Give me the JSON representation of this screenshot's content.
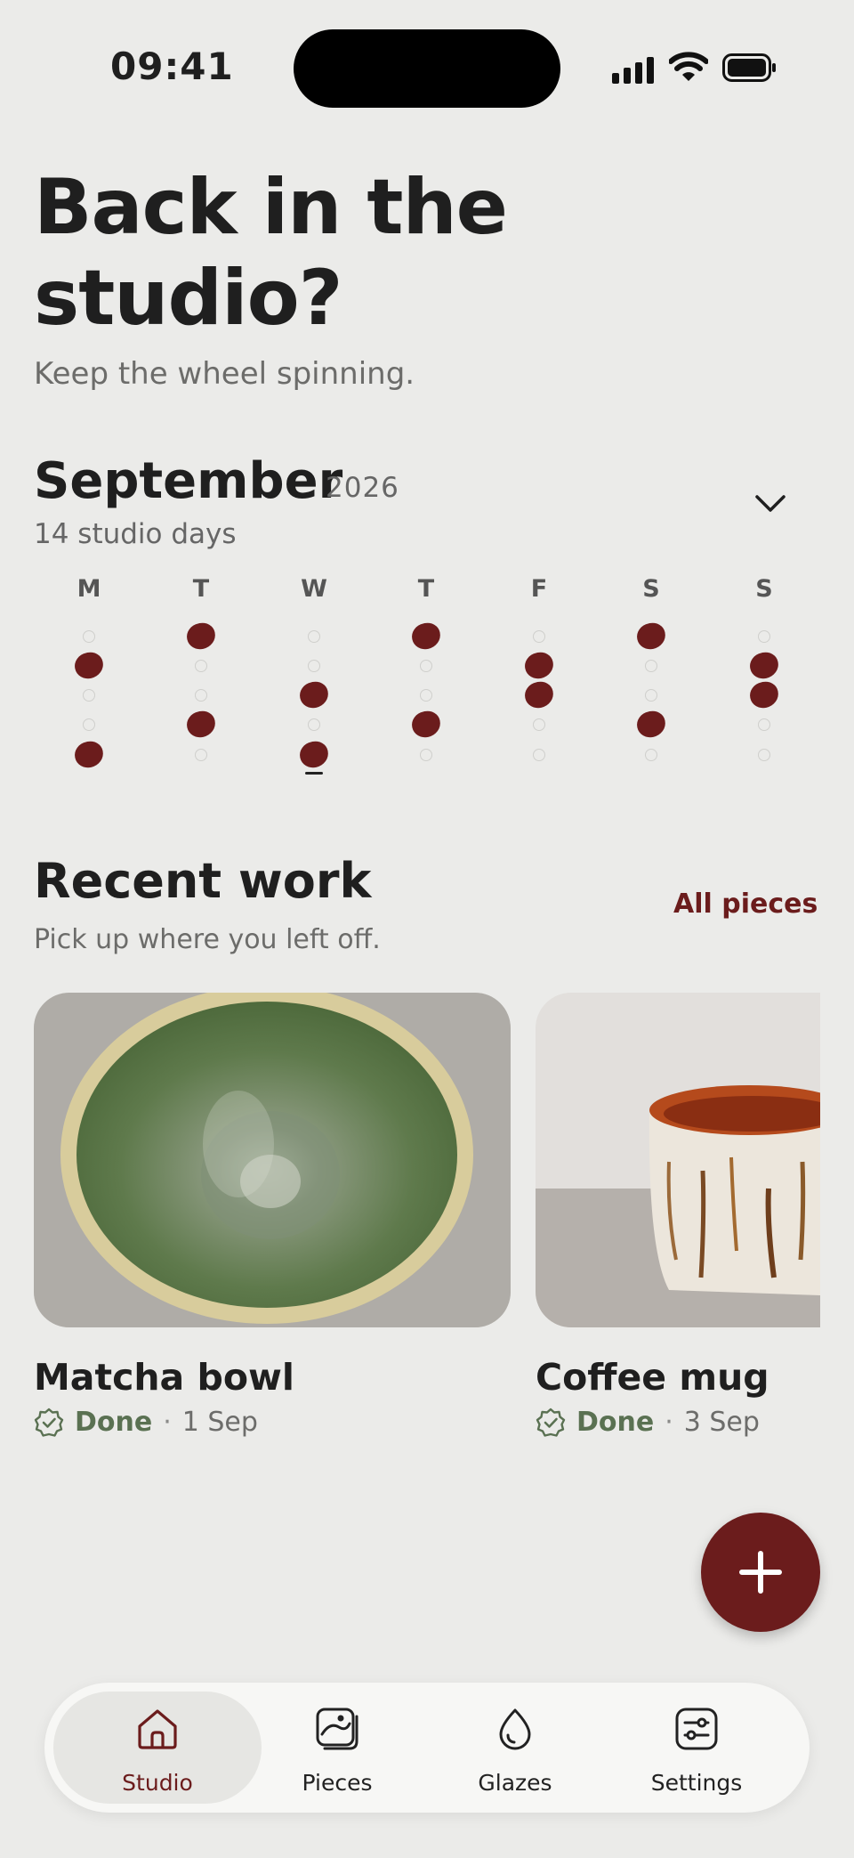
{
  "status_bar": {
    "time": "09:41"
  },
  "hero": {
    "title": "Back in the studio?",
    "subtitle": "Keep the wheel spinning."
  },
  "calendar": {
    "month": "September",
    "year": "2026",
    "studio_days": "14 studio days",
    "weekdays": [
      "M",
      "T",
      "W",
      "T",
      "F",
      "S",
      "S"
    ],
    "grid": [
      [
        0,
        1,
        0,
        0,
        1
      ],
      [
        1,
        0,
        0,
        1,
        0
      ],
      [
        0,
        0,
        1,
        0,
        1
      ],
      [
        1,
        0,
        0,
        1,
        0
      ],
      [
        0,
        1,
        1,
        0,
        0
      ],
      [
        1,
        0,
        0,
        1,
        0
      ],
      [
        0,
        1,
        1,
        0,
        0
      ]
    ],
    "today": [
      2,
      4
    ]
  },
  "recent": {
    "title": "Recent work",
    "subtitle": "Pick up where you left off.",
    "all_link": "All pieces",
    "pieces": [
      {
        "name": "Matcha bowl",
        "status": "Done",
        "date": "1 Sep"
      },
      {
        "name": "Coffee mug",
        "status": "Done",
        "date": "3 Sep"
      }
    ]
  },
  "fab": {
    "icon": "plus-icon"
  },
  "nav": {
    "items": [
      {
        "label": "Studio",
        "icon": "home-icon",
        "active": true
      },
      {
        "label": "Pieces",
        "icon": "pieces-icon",
        "active": false
      },
      {
        "label": "Glazes",
        "icon": "drop-icon",
        "active": false
      },
      {
        "label": "Settings",
        "icon": "sliders-icon",
        "active": false
      }
    ]
  },
  "colors": {
    "accent": "#6b1c1c",
    "done": "#5a7152",
    "background": "#ebebe9"
  }
}
